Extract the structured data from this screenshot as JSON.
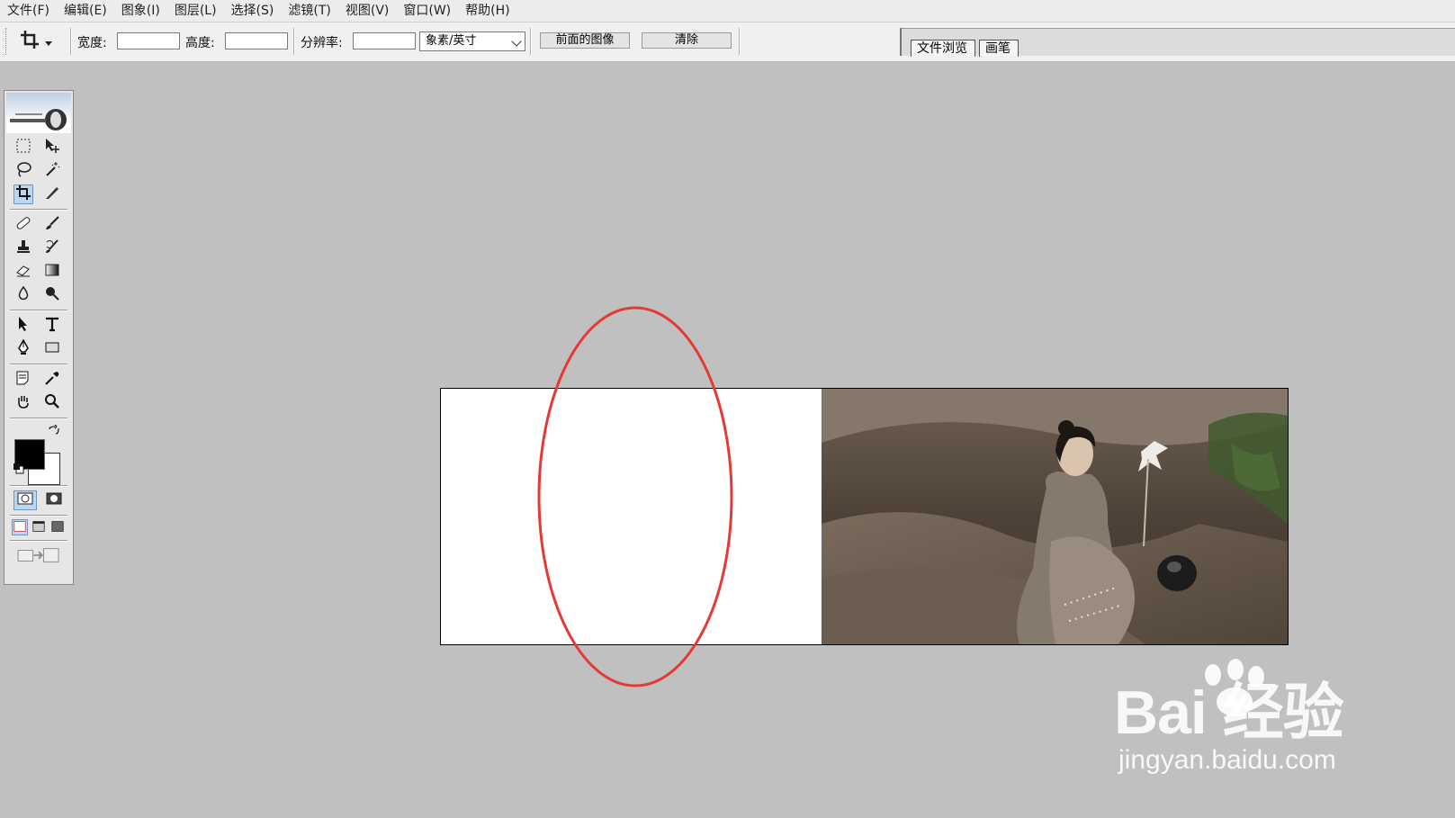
{
  "menu": [
    {
      "label": "文件(F)"
    },
    {
      "label": "编辑(E)"
    },
    {
      "label": "图象(I)"
    },
    {
      "label": "图层(L)"
    },
    {
      "label": "选择(S)"
    },
    {
      "label": "滤镜(T)"
    },
    {
      "label": "视图(V)"
    },
    {
      "label": "窗口(W)"
    },
    {
      "label": "帮助(H)"
    }
  ],
  "options_bar": {
    "width_label": "宽度:",
    "width_value": "",
    "height_label": "高度:",
    "height_value": "",
    "resolution_label": "分辨率:",
    "resolution_value": "",
    "unit_selected": "象素/英寸",
    "front_image_button": "前面的图像",
    "clear_button": "清除",
    "tool_icon": "crop-icon"
  },
  "palette_well": {
    "tabs": [
      {
        "label": "文件浏览"
      },
      {
        "label": "画笔"
      }
    ]
  },
  "toolbox": {
    "active_tool": "crop",
    "foreground_color": "#000000",
    "background_color": "#ffffff"
  },
  "canvas": {
    "background": "#c0c0c0",
    "annotation_color": "#e53935"
  },
  "watermark": {
    "brand": "Bai 经验",
    "url": "jingyan.baidu.com"
  }
}
